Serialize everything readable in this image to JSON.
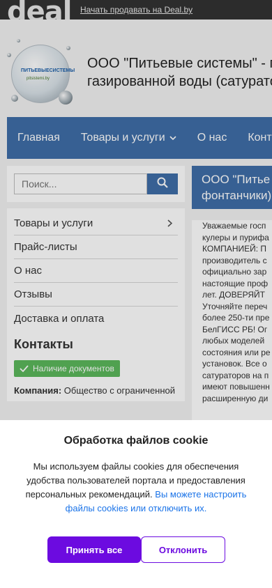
{
  "topbar": {
    "logo": "deal",
    "sell_link": "Начать продавать на Deal.by"
  },
  "header": {
    "logo_text": "ПИТЬЕВЫЕСИСТЕМЫ",
    "logo_sub": "pitsistemi.by",
    "company_title_line1": "ООО \"Питьевые системы\" - п",
    "company_title_line2": "газированной воды (сатурато"
  },
  "nav": {
    "items": [
      {
        "label": "Главная"
      },
      {
        "label": "Товары и услуги",
        "icon": "chevron-down-icon"
      },
      {
        "label": "О нас"
      },
      {
        "label": "Конта"
      }
    ]
  },
  "sidebar": {
    "search_placeholder": "Поиск...",
    "search_icon": "search-icon",
    "menu": [
      {
        "label": "Товары и услуги",
        "icon": "chevron-right-icon"
      },
      {
        "label": "Прайс-листы"
      },
      {
        "label": "О нас"
      },
      {
        "label": "Отзывы"
      },
      {
        "label": "Доставка и оплата"
      }
    ],
    "contacts_title": "Контакты",
    "docs_badge": "Наличие документов",
    "company_label": "Компания:",
    "company_value": "Общество с ограниченной"
  },
  "main": {
    "head_line1": "ООО \"Питье",
    "head_line2": "фонтанчики)",
    "body_lines": [
      "Уважаемые госп",
      "кулеры и пурифа",
      "КОМПАНИЕЙ: П",
      "производитель с",
      "официально зар",
      "настоящие проф",
      "лет. ДОВЕРЯЙТ",
      "Уточняйте переч",
      "более 250-ти пре",
      "БелГИСС РБ! Ог",
      "любых моделей",
      "состояния или ре",
      "установок. Все о",
      "сатураторов на п",
      "имеют повышенн",
      "расширенную ди"
    ]
  },
  "cookie": {
    "title": "Обработка файлов cookie",
    "text": "Мы используем файлы cookies для обеспечения удобства пользователей портала и предоставления персональных рекомендаций.",
    "link": "Вы можете настроить файлы cookies или отключить их.",
    "accept": "Принять все",
    "decline": "Отклонить"
  },
  "colors": {
    "nav_blue": "#3f6ea8",
    "accent_purple": "#6c0be0",
    "badge_green": "#5cb85c",
    "link_blue": "#1a73e8"
  }
}
